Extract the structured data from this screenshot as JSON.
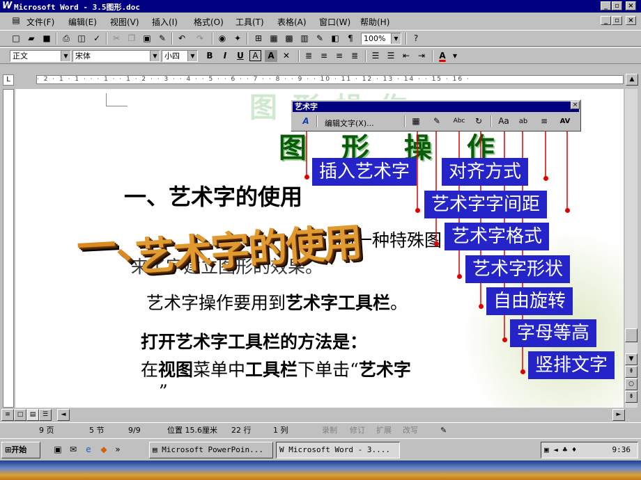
{
  "window": {
    "title": "Microsoft Word - 3.5图形.doc",
    "logo": "W"
  },
  "menu": [
    "文件(F)",
    "编辑(E)",
    "视图(V)",
    "插入(I)",
    "格式(O)",
    "工具(T)",
    "表格(A)",
    "窗口(W)",
    "帮助(H)"
  ],
  "toolbar": {
    "zoom": "100%"
  },
  "format_toolbar": {
    "style": "正文",
    "font": "宋体",
    "size": "小四",
    "bold": "B",
    "italic": "I",
    "underline": "U",
    "char_border": "A",
    "char_shade": "A",
    "font_color": "A"
  },
  "ruler": {
    "marks": "· 2 · 1 · 1 · · · 1 · · 1 · 2 · · 3 · · 4 · · 5 · · 6 · · 7 · · 8 · · 9 · · 10 · 11 · 12 · 13 · 14 · · 15 · 16 ·"
  },
  "wordart_toolbar": {
    "title": "艺术字",
    "close": "×",
    "edit_text": "编辑文字(X)..."
  },
  "document": {
    "bg_title": "图 形 操 作",
    "faint_title": "图  形  操  作",
    "heading": "一、艺术字的使用",
    "wordart_text": "艺术字的使用",
    "wordart_prefix": "一、",
    "line1_visible_end": "的一种特殊图",
    "line2": "来了字建立图形的效果。",
    "line3_a": "艺术字操作要用到",
    "line3_b": "艺术字工具栏",
    "line3_c": "。",
    "line4": "打开艺术字工具栏的方法是：",
    "line5_a": "在",
    "line5_b": "视图",
    "line5_c": "菜单中",
    "line5_d": "工具栏",
    "line5_e": "下单击“",
    "line5_f": "艺术字",
    "line6": "”"
  },
  "callouts": [
    "插入艺术字",
    "对齐方式",
    "艺术字字间距",
    "艺术字格式",
    "艺术字形状",
    "自由旋转",
    "字母等高",
    "竖排文字"
  ],
  "status": {
    "page": "9 页",
    "section": "5 节",
    "count": "9/9",
    "position": "位置 15.6厘米",
    "line": "22 行",
    "col": "1 列",
    "rec": "录制",
    "trk": "修订",
    "ext": "扩展",
    "ovr": "改写"
  },
  "taskbar": {
    "start": "开始",
    "task1": "Microsoft PowerPoin...",
    "task2": "Microsoft Word - 3....",
    "clock": "9:36"
  },
  "colors": {
    "titlebar": "#000080",
    "callout": "#2424c8",
    "wordart": "#d98a20",
    "pointer": "#e00000"
  }
}
